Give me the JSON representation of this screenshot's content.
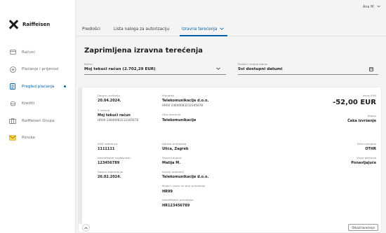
{
  "app": {
    "brand": "Raiffeisen"
  },
  "user": {
    "name": "Ana M."
  },
  "sidebar": {
    "items": [
      {
        "label": "Računi",
        "icon": "card-icon"
      },
      {
        "label": "Plaćanje i prijenosi",
        "icon": "transfer-icon"
      },
      {
        "label": "Pregled plaćanja",
        "icon": "document-icon",
        "active": true
      },
      {
        "label": "Krediti",
        "icon": "coins-icon"
      },
      {
        "label": "Raiffeisen Grupa",
        "icon": "building-icon"
      },
      {
        "label": "Poruke",
        "icon": "mail-icon"
      }
    ]
  },
  "tabs": {
    "items": [
      {
        "label": "Predlošci"
      },
      {
        "label": "Lista naloga za autorizaciju"
      },
      {
        "label": "Izravna terećenja"
      }
    ]
  },
  "page": {
    "title": "Zaprimljena izravna terećenja",
    "account_label": "Račun",
    "account_value": "Moj tekući račun (2.702,29 EUR)",
    "period_label": "Početni i krajnji datum",
    "period_value": "Svi dostupni datumi"
  },
  "detail": {
    "due_date_label": "Datum izvršenja",
    "due_date": "20.04.2024.",
    "from_account_label": "S računa",
    "from_account_name": "Moj tekući račun",
    "from_account_iban": "HR00 2484008321234567B",
    "payee_label": "Primatelj",
    "payee_name": "Telekomunikacije d.o.o.",
    "payee_iban": "HR00 2484008321234567B",
    "description_label": "Opis plaćanja",
    "description": "Telekomunikacije",
    "amount_label": "Iznos EUR",
    "amount": "-52,00 EUR",
    "status_label": "Status",
    "status": "Čeka izvršenje",
    "sdd_label": "SDD referenca",
    "sdd": "1111111",
    "consent_label": "Identifikator suglasnosti",
    "consent": "123456789",
    "consent_date_label": "Datum zaprimanja",
    "consent_date": "26.02.2024.",
    "payee_address_label": "Adresa primatelja",
    "payee_address": "Ulica, Zagreb",
    "debtor_label": "Stvarni dužnik",
    "debtor": "Matija M.",
    "final_payee_label": "Krajnji primatelj",
    "final_payee": "Telekomunikacije d.o.o.",
    "model_label": "Model i poziv na broj primatelja",
    "model": "HR99",
    "payee_id_label": "Identifikator primatelja",
    "payee_id": "HR123456789",
    "purpose_label": "Šifra namjene",
    "purpose": "OTHR",
    "payment_type_label": "Vrsta plaćanja",
    "payment_type": "Ponavljajuće"
  },
  "actions": {
    "cancel_label": "Otkaži terećenje"
  }
}
